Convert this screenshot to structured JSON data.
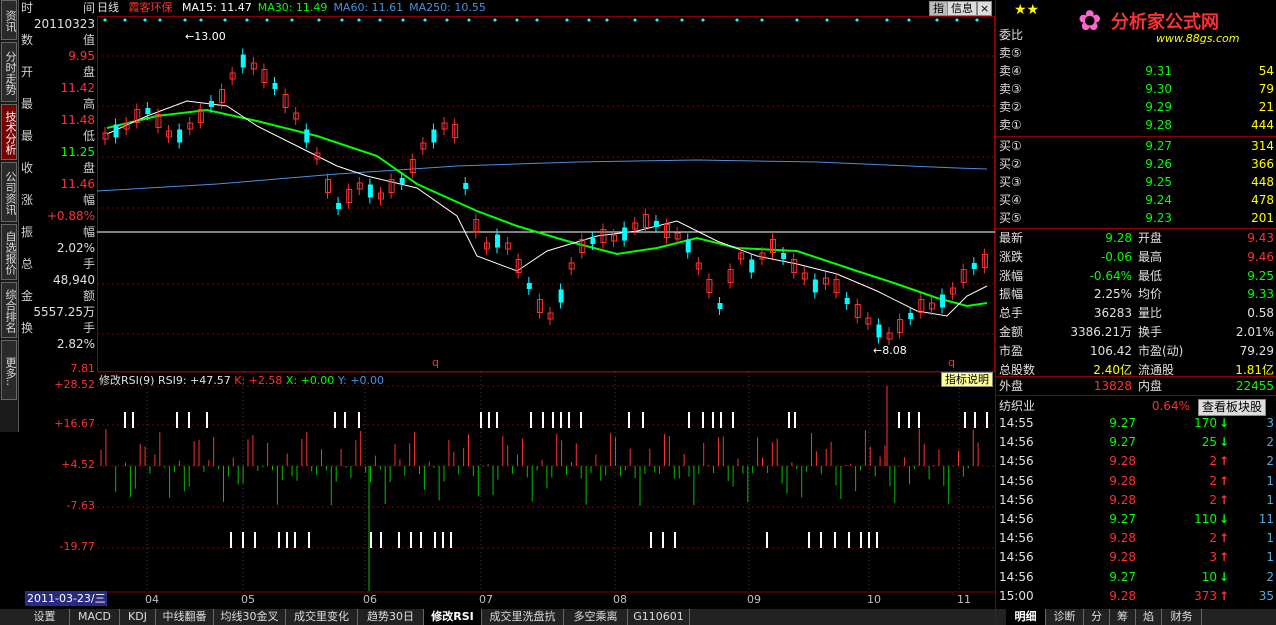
{
  "stock_name": "霞客环保",
  "period": "日线",
  "ma": [
    {
      "label": "MA15: 11.47",
      "color": "#ffffff"
    },
    {
      "label": "MA30: 11.49",
      "color": "#00ff00"
    },
    {
      "label": "MA60: 11.61",
      "color": "#4a90e2"
    },
    {
      "label": "MA250: 10.55",
      "color": "#4a90e2"
    }
  ],
  "left_tabs": [
    "资讯",
    "分时走势",
    "技术分析",
    "公司资讯",
    "自选报价",
    "综合排名",
    "更多.."
  ],
  "info": [
    {
      "l": "时",
      "r": "间"
    },
    {
      "v": "20110323",
      "c": "#e0e0e0"
    },
    {
      "l": "数",
      "r": "值"
    },
    {
      "v": "9.95",
      "c": "#ff3030"
    },
    {
      "l": "开",
      "r": "盘"
    },
    {
      "v": "11.42",
      "c": "#ff3030"
    },
    {
      "l": "最",
      "r": "高"
    },
    {
      "v": "11.48",
      "c": "#ff3030"
    },
    {
      "l": "最",
      "r": "低"
    },
    {
      "v": "11.25",
      "c": "#00ff00"
    },
    {
      "l": "收",
      "r": "盘"
    },
    {
      "v": "11.46",
      "c": "#ff3030"
    },
    {
      "l": "涨",
      "r": "幅"
    },
    {
      "v": "+0.88%",
      "c": "#ff3030"
    },
    {
      "l": "振",
      "r": "幅"
    },
    {
      "v": "2.02%",
      "c": "#e0e0e0"
    },
    {
      "l": "总",
      "r": "手"
    },
    {
      "v": "48,940",
      "c": "#e0e0e0"
    },
    {
      "l": "金",
      "r": "额"
    },
    {
      "v": "5557.25万",
      "c": "#e0e0e0"
    },
    {
      "l": "换",
      "r": "手"
    },
    {
      "v": "2.82%",
      "c": "#e0e0e0"
    }
  ],
  "buttons": {
    "zhi": "指",
    "xinxi": "信息",
    "zhibiao": "指标说明",
    "chakan": "查看板块股"
  },
  "price_labels": {
    "high": "13.00",
    "low": "8.08",
    "bottom": "7.81",
    "q1": "q",
    "q2": "q"
  },
  "rsi": {
    "title": "修改RSI(9)",
    "rsi9": "RSI9: +47.57",
    "k": "K: +2.58",
    "x": "X: +0.00",
    "y": "Y: +0.00",
    "ticks": [
      "+28.52",
      "+16.67",
      "+4.52",
      "-7.63",
      "-19.77"
    ]
  },
  "months": [
    "04",
    "05",
    "06",
    "07",
    "08",
    "09",
    "10",
    "11"
  ],
  "date_label": "2011-03-23/三",
  "bottom_tabs": [
    "设置",
    "MACD",
    "KDJ",
    "中线翻番",
    "均线30金叉",
    "成交里变化",
    "趋势30日",
    "修改RSI",
    "成交里洗盘抗",
    "多空乘离",
    "G110601"
  ],
  "right_tabs": [
    "明细",
    "诊断",
    "分",
    "筹",
    "焰",
    "财务"
  ],
  "logo": {
    "text": "分析家公式网",
    "url": "www.88gs.com"
  },
  "weibi_label": "委比",
  "sell": [
    {
      "l": "卖⑤",
      "p": "",
      "v": ""
    },
    {
      "l": "卖④",
      "p": "9.31",
      "v": "54"
    },
    {
      "l": "卖③",
      "p": "9.30",
      "v": "79"
    },
    {
      "l": "卖②",
      "p": "9.29",
      "v": "21"
    },
    {
      "l": "卖①",
      "p": "9.28",
      "v": "444"
    }
  ],
  "buy": [
    {
      "l": "买①",
      "p": "9.27",
      "v": "314"
    },
    {
      "l": "买②",
      "p": "9.26",
      "v": "366"
    },
    {
      "l": "买③",
      "p": "9.25",
      "v": "448"
    },
    {
      "l": "买④",
      "p": "9.24",
      "v": "478"
    },
    {
      "l": "买⑤",
      "p": "9.23",
      "v": "201"
    }
  ],
  "stats": [
    {
      "l1": "最新",
      "v1": "9.28",
      "c1": "g",
      "l2": "开盘",
      "v2": "9.43",
      "c2": "r"
    },
    {
      "l1": "涨跌",
      "v1": "-0.06",
      "c1": "g",
      "l2": "最高",
      "v2": "9.46",
      "c2": "r"
    },
    {
      "l1": "涨幅",
      "v1": "-0.64%",
      "c1": "g",
      "l2": "最低",
      "v2": "9.25",
      "c2": "g"
    },
    {
      "l1": "振幅",
      "v1": "2.25%",
      "c1": "w",
      "l2": "均价",
      "v2": "9.33",
      "c2": "g"
    },
    {
      "l1": "总手",
      "v1": "36283",
      "c1": "w",
      "l2": "量比",
      "v2": "0.58",
      "c2": "w"
    },
    {
      "l1": "金额",
      "v1": "3386.21万",
      "c1": "w",
      "l2": "换手",
      "v2": "2.01%",
      "c2": "w"
    },
    {
      "l1": "市盈",
      "v1": "106.42",
      "c1": "w",
      "l2": "市盈(动)",
      "v2": "79.29",
      "c2": "w"
    },
    {
      "l1": "总股数",
      "v1": "2.40亿",
      "c1": "y",
      "l2": "流通股",
      "v2": "1.81亿",
      "c2": "y"
    }
  ],
  "outer": {
    "l1": "外盘",
    "v1": "13828",
    "l2": "内盘",
    "v2": "22455"
  },
  "sector": {
    "name": "纺织业",
    "pct": "0.64%"
  },
  "trades": [
    {
      "t": "14:55",
      "p": "9.27",
      "v": "170",
      "d": "down",
      "n": "3"
    },
    {
      "t": "14:56",
      "p": "9.27",
      "v": "25",
      "d": "down",
      "n": "2"
    },
    {
      "t": "14:56",
      "p": "9.28",
      "v": "2",
      "d": "up",
      "n": "2"
    },
    {
      "t": "14:56",
      "p": "9.28",
      "v": "2",
      "d": "up",
      "n": "1"
    },
    {
      "t": "14:56",
      "p": "9.28",
      "v": "2",
      "d": "up",
      "n": "1"
    },
    {
      "t": "14:56",
      "p": "9.27",
      "v": "110",
      "d": "down",
      "n": "11"
    },
    {
      "t": "14:56",
      "p": "9.28",
      "v": "2",
      "d": "up",
      "n": "1"
    },
    {
      "t": "14:56",
      "p": "9.28",
      "v": "3",
      "d": "up",
      "n": "1"
    },
    {
      "t": "14:56",
      "p": "9.27",
      "v": "10",
      "d": "down",
      "n": "2"
    },
    {
      "t": "15:00",
      "p": "9.28",
      "v": "373",
      "d": "up",
      "n": "35"
    }
  ],
  "colors": {
    "up": "#ff3030",
    "down": "#00ffff",
    "ma15": "#ffffff",
    "ma30": "#00ff00",
    "ma60": "#4a90e2",
    "grid": "#800000"
  }
}
